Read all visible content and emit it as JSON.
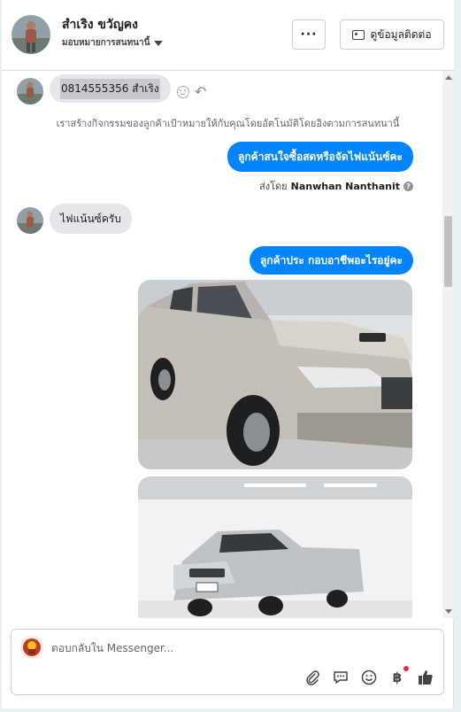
{
  "header": {
    "contact_name": "สำเริง ขวัญคง",
    "assign_label": "มอบหมายการสนทนานี้",
    "more_label": "···",
    "view_contact_label": "ดูข้อมูลติดต่อ"
  },
  "messages": {
    "incoming_phone": "0814555356 สำเริง",
    "system_note": "เราสร้างกิจกรรมของลูกค้าเป้าหมายให้กับคุณโดยอัตโนมัติโดยอิงตามการสนทนานี้",
    "outgoing_1": "ลูกค้าสนใจซื้อสดหรือจัดไฟแน้นซ์คะ",
    "sent_by_prefix": "ส่งโดย",
    "sent_by_name": "Nanwhan Nanthanit",
    "incoming_2": "ไฟแน้นซ์ครับ",
    "outgoing_2": "ลูกค้าประ กอบอาชีพอะไรอยู่คะ"
  },
  "composer": {
    "placeholder": "ตอบกลับใน Messenger..."
  },
  "icons": [
    "more-icon",
    "contact-card-icon",
    "smile-icon",
    "reply-icon",
    "question-icon",
    "attach-icon",
    "saved-reply-icon",
    "emoji-icon",
    "baht-icon",
    "like-icon"
  ],
  "colors": {
    "accent": "#0084ff",
    "incoming_bubble": "#e4e6eb",
    "badge": "#f02849"
  }
}
